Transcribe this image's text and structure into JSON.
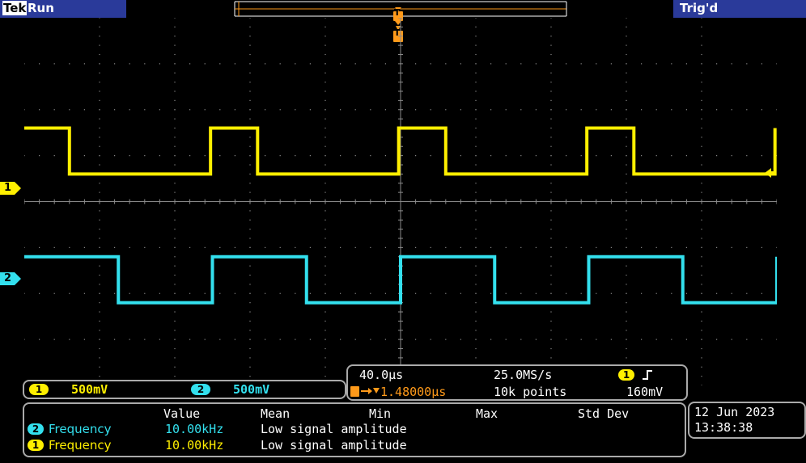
{
  "header": {
    "brand": "Tek",
    "acq_state": "Run",
    "trigger_status": "Trig'd"
  },
  "channels": [
    {
      "number": "1",
      "scale": "500mV",
      "color": "#ffef00"
    },
    {
      "number": "2",
      "scale": "500mV",
      "color": "#33e0ee"
    }
  ],
  "timebase": {
    "horizontal_scale": "40.0µs",
    "trigger_position": "1.48000µs",
    "sample_rate": "25.0MS/s",
    "record_length": "10k points",
    "trigger_source": "1",
    "trigger_slope_icon": "rising-edge-icon",
    "trigger_level": "160mV"
  },
  "measurements": {
    "columns": [
      "Value",
      "Mean",
      "Min",
      "Max",
      "Std Dev"
    ],
    "rows": [
      {
        "channel": "2",
        "name": "Frequency",
        "value": "10.00kHz",
        "note": "Low signal amplitude"
      },
      {
        "channel": "1",
        "name": "Frequency",
        "value": "10.00kHz",
        "note": "Low signal amplitude"
      }
    ]
  },
  "datetime": {
    "date": "12 Jun 2023",
    "time": "13:38:38"
  },
  "markers": {
    "trigger_marker": "T",
    "ch1_marker": "1",
    "ch2_marker": "2"
  },
  "colors": {
    "status_bar": "#2a3a9a",
    "ch1": "#ffef00",
    "ch2": "#33e0ee",
    "trigger": "#ff9a1a",
    "grid": "#8a8a8a"
  },
  "waveforms": {
    "ch1": {
      "high_div": 1.6,
      "low_div": 0.6,
      "period_div": 2.5,
      "duty": 0.25
    },
    "ch2": {
      "high_div": -1.2,
      "low_div": -2.2,
      "period_div": 2.5,
      "duty": 0.5
    }
  }
}
